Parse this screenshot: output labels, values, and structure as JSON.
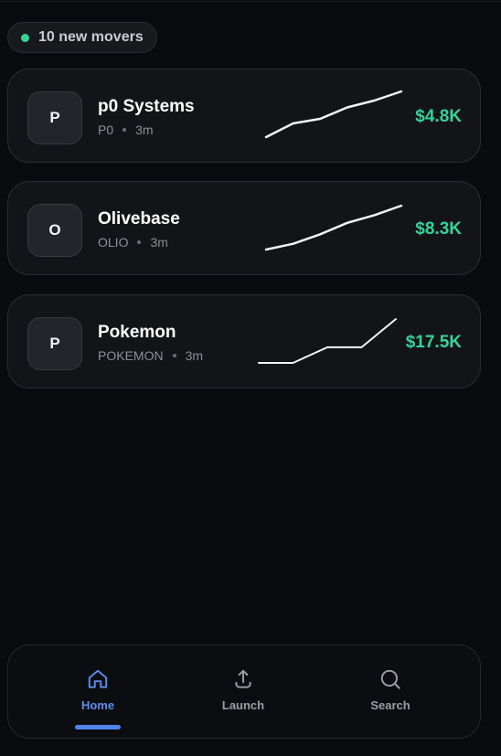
{
  "banner": {
    "label": "10 new movers",
    "dot_color": "#34d399"
  },
  "tokens": [
    {
      "initial": "P",
      "name": "p0 Systems",
      "ticker": "P0",
      "age": "3m",
      "price": "$4.8K",
      "trend": [
        2,
        8,
        10,
        15,
        18,
        22
      ]
    },
    {
      "initial": "O",
      "name": "Olivebase",
      "ticker": "OLIO",
      "age": "3m",
      "price": "$8.3K",
      "trend": [
        2,
        5,
        10,
        16,
        20,
        25
      ]
    },
    {
      "initial": "P",
      "name": "Pokemon",
      "ticker": "POKEMON",
      "age": "3m",
      "price": "$17.5K",
      "trend": [
        0,
        0,
        5,
        5,
        14
      ]
    }
  ],
  "nav": {
    "items": [
      {
        "label": "Home",
        "icon": "home-icon",
        "active": true
      },
      {
        "label": "Launch",
        "icon": "upload-icon",
        "active": false
      },
      {
        "label": "Search",
        "icon": "search-icon",
        "active": false
      }
    ]
  },
  "colors": {
    "accent": "#4f85ea",
    "positive": "#34d399"
  }
}
